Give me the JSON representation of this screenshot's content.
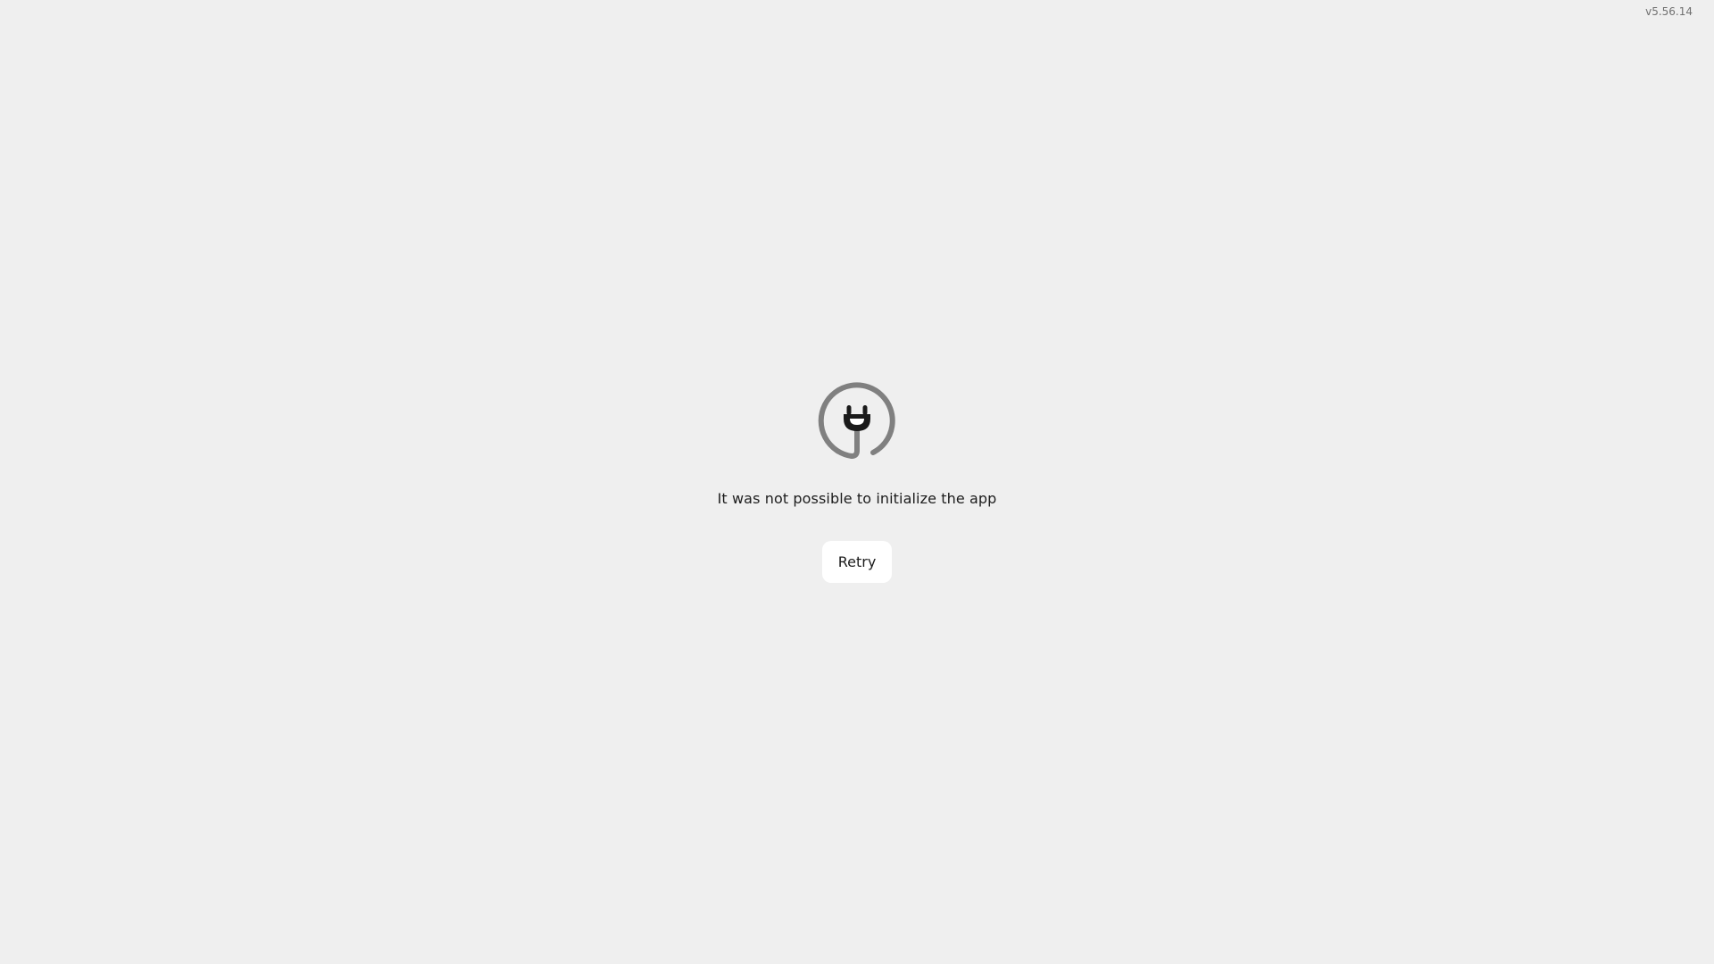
{
  "app": {
    "version": "v5.56.14"
  },
  "error": {
    "icon": "plug-icon",
    "message": "It was not possible to initialize the app",
    "retry_label": "Retry"
  },
  "colors": {
    "background": "#efefef",
    "icon_ring": "#808080",
    "icon_plug": "#1a1a1a",
    "button_bg": "#ffffff",
    "text": "#1c1c1c",
    "version_text": "#707070"
  }
}
